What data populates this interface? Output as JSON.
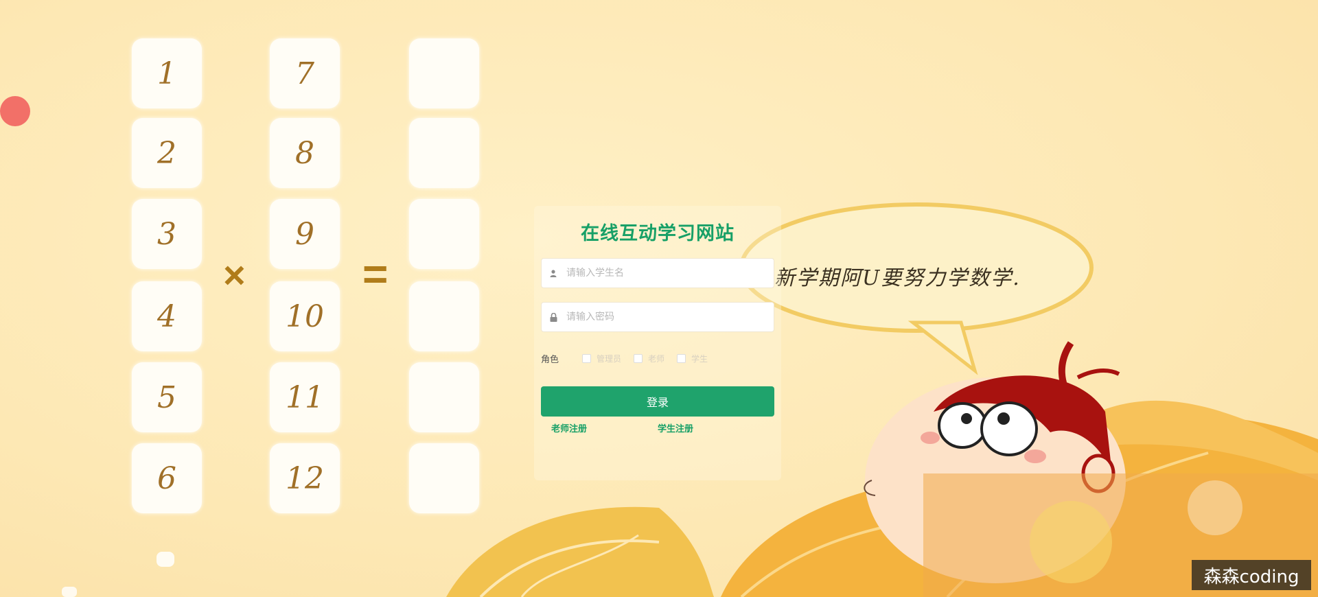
{
  "math": {
    "left_column": [
      "1",
      "2",
      "3",
      "4",
      "5",
      "6"
    ],
    "middle_column": [
      "7",
      "8",
      "9",
      "10",
      "11",
      "12"
    ],
    "times_symbol": "×",
    "equals_symbol": "="
  },
  "login": {
    "title": "在线互动学习网站",
    "username_placeholder": "请输入学生名",
    "password_placeholder": "请输入密码",
    "role_label": "角色",
    "role_options": [
      "管理员",
      "老师",
      "学生"
    ],
    "login_button": "登录",
    "teacher_register": "老师注册",
    "student_register": "学生注册"
  },
  "illustration": {
    "speech_bubble_text": "新学期阿U要努力学数学."
  },
  "watermark": "森森coding",
  "colors": {
    "background": "#fdeab8",
    "accent_green": "#1fa36c",
    "card_digit": "#a07028"
  },
  "icons": {
    "user": "user-icon",
    "lock": "lock-icon"
  }
}
